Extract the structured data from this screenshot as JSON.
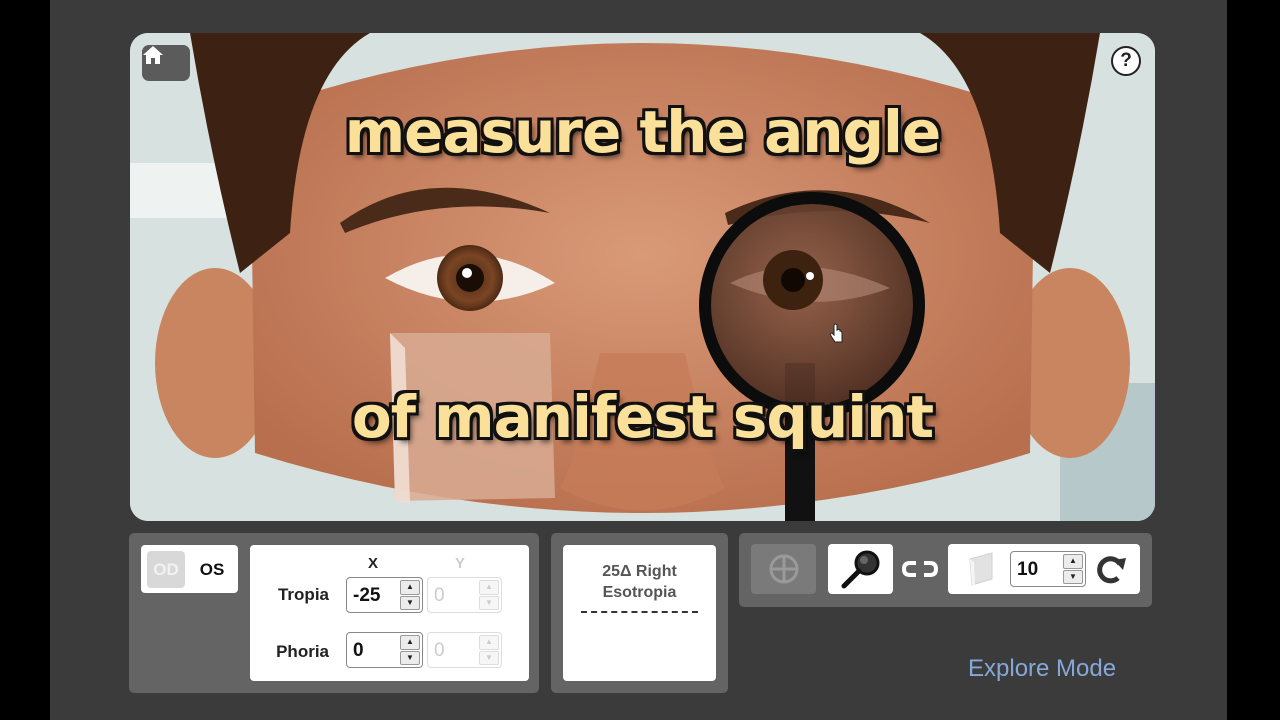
{
  "app": {
    "captions": {
      "line1": "measure the angle",
      "line2": "of manifest squint"
    },
    "help_label": "?"
  },
  "eye_toggle": {
    "od_label": "OD",
    "os_label": "OS",
    "selected": "OS"
  },
  "measurements": {
    "x_header": "X",
    "y_header": "Y",
    "tropia_label": "Tropia",
    "phoria_label": "Phoria",
    "tropia_x": "-25",
    "tropia_y": "0",
    "phoria_x": "0",
    "phoria_y": "0"
  },
  "diagnosis": {
    "text": "25Δ Right\nEsotropia"
  },
  "tools": {
    "prism_value": "10",
    "icons": [
      "crosshair-icon",
      "magnifier-icon",
      "link-icon",
      "prism-icon",
      "rotate-icon"
    ]
  },
  "explore_mode_label": "Explore Mode",
  "colors": {
    "frame": "#3b3b3b",
    "panel": "#646464",
    "caption": "#fbe09a",
    "link": "#86a8d8"
  }
}
